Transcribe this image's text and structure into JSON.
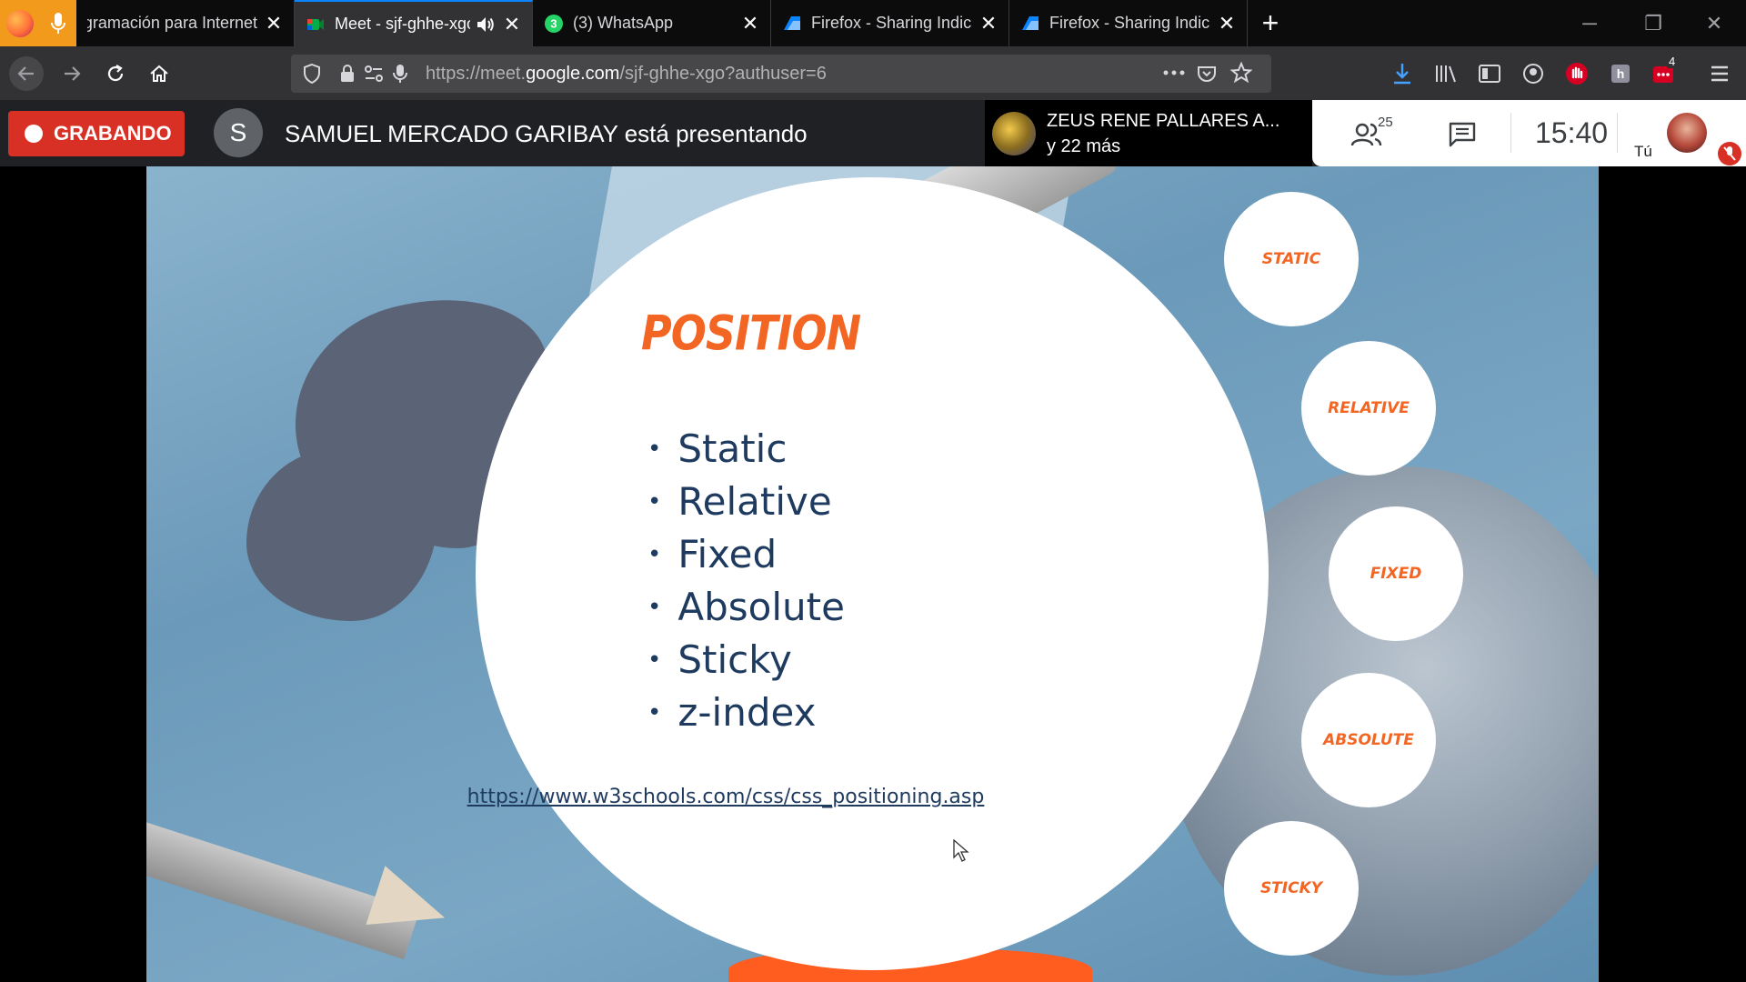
{
  "browser": {
    "tabs": [
      {
        "title": "Programación para Internet",
        "active": false,
        "favicon": "mic-icon"
      },
      {
        "title": "Meet - sjf-ghhe-xgo",
        "active": true,
        "favicon": "google-meet-icon"
      },
      {
        "title": "(3) WhatsApp",
        "active": false,
        "favicon": "whatsapp-icon",
        "badge": "3"
      },
      {
        "title": "Firefox - Sharing Indicator - C",
        "active": false,
        "favicon": "firefox-sharing-icon"
      },
      {
        "title": "Firefox - Sharing Indicator - C",
        "active": false,
        "favicon": "firefox-sharing-icon"
      }
    ],
    "url_prefix": "https://meet.",
    "url_domain": "google.com",
    "url_path": "/sjf-ghhe-xgo?authuser=6",
    "extension_badge": "4"
  },
  "meet": {
    "recording_label": "GRABANDO",
    "presenter_initial": "S",
    "presenter_text": "SAMUEL MERCADO GARIBAY está presentando",
    "speaker_name": "ZEUS RENE PALLARES A...",
    "speaker_more": "y 22 más",
    "participant_count": "25",
    "clock": "15:40",
    "self_label": "Tú"
  },
  "slide": {
    "title": "POSITION",
    "bullets": [
      "Static",
      "Relative",
      "Fixed",
      "Absolute",
      "Sticky",
      "z-index"
    ],
    "link": "https://www.w3schools.com/css/css_positioning.asp",
    "side_items": [
      "STATIC",
      "RELATIVE",
      "FIXED",
      "ABSOLUTE",
      "STICKY"
    ]
  },
  "colors": {
    "record_red": "#d93025",
    "slide_orange": "#f26522",
    "slide_text": "#1f3a5f",
    "tab_accent": "#0a84ff"
  }
}
